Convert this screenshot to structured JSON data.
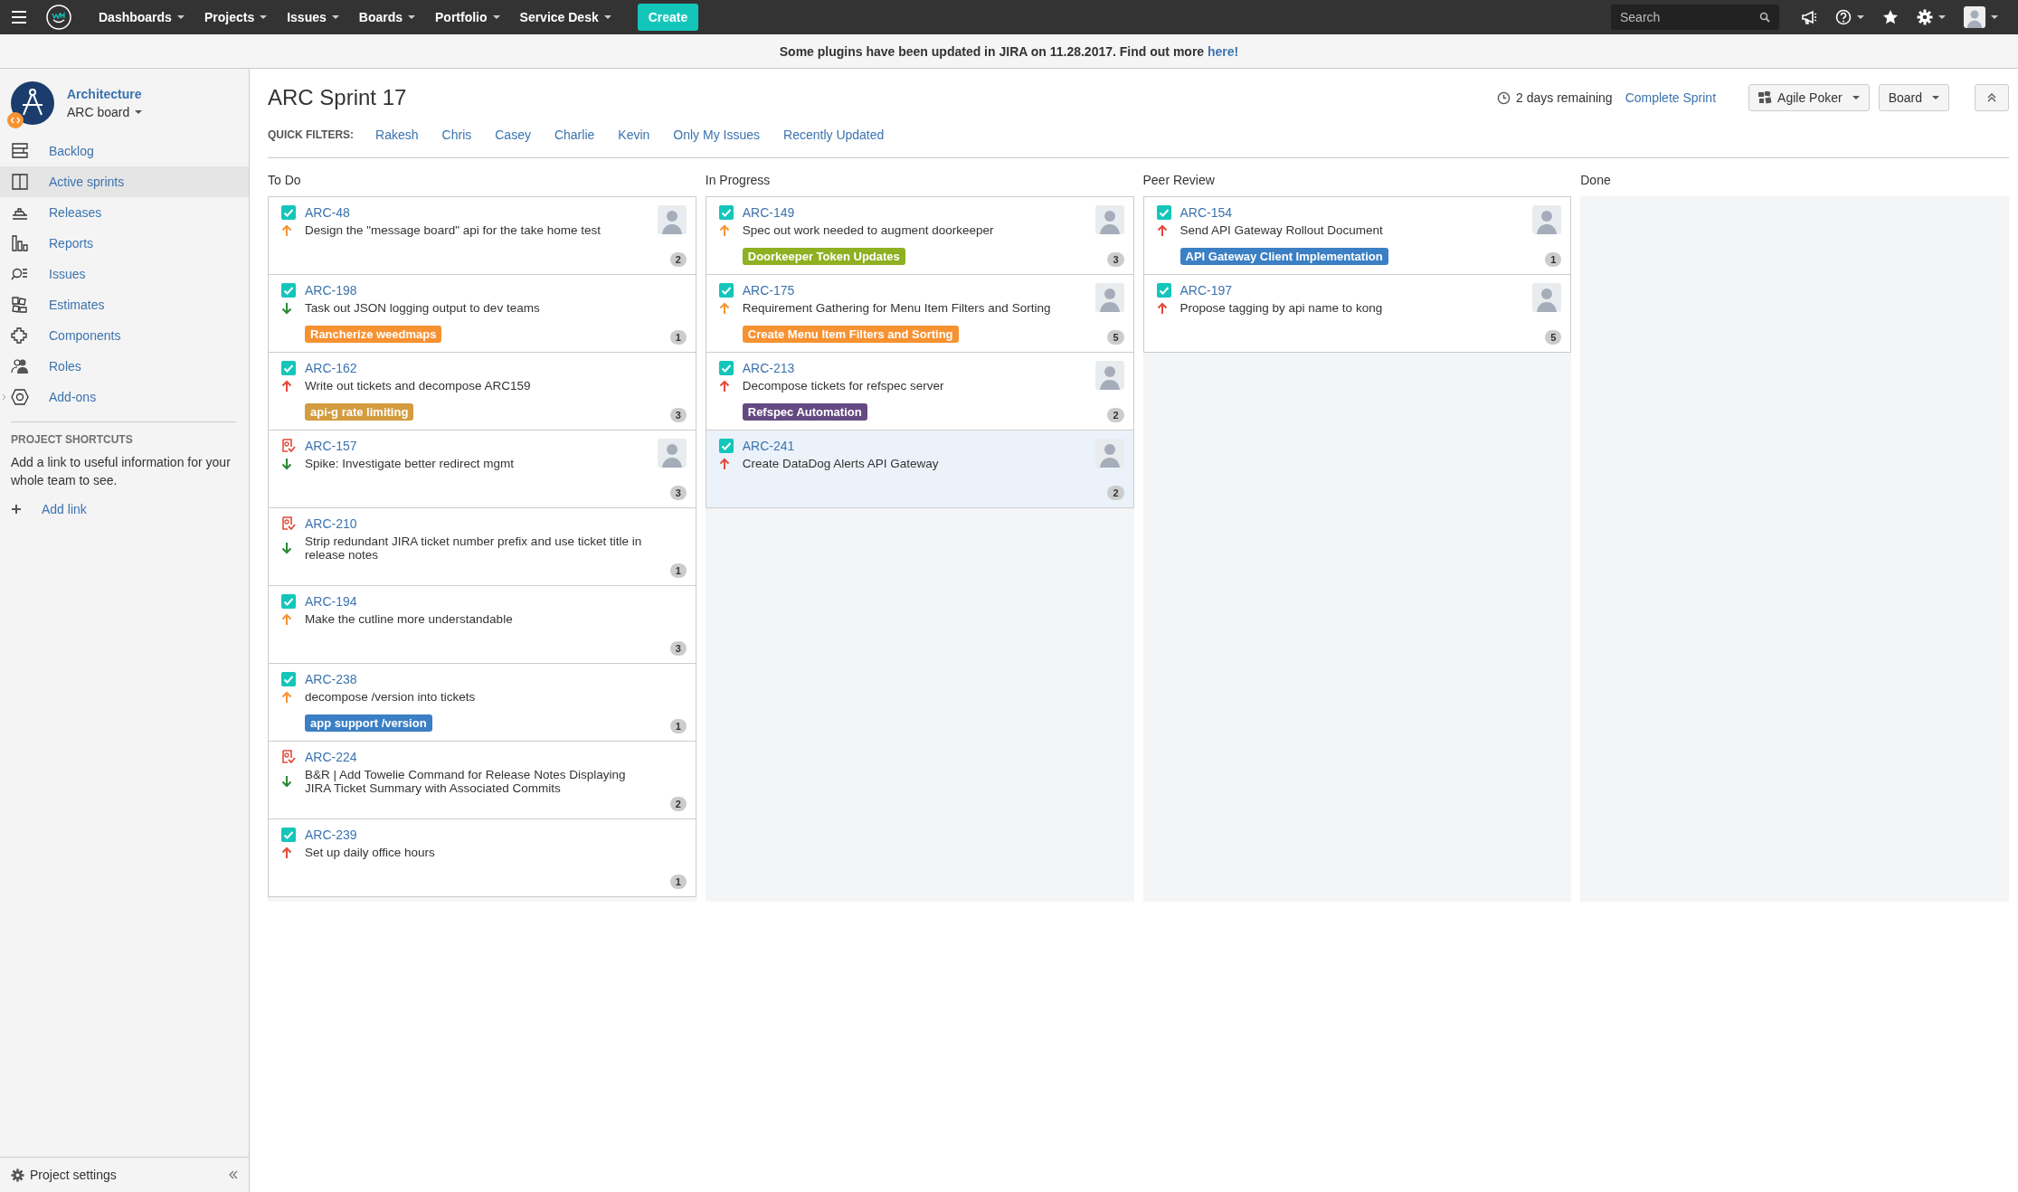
{
  "top_nav": {
    "menus": [
      {
        "label": "Dashboards"
      },
      {
        "label": "Projects"
      },
      {
        "label": "Issues"
      },
      {
        "label": "Boards"
      },
      {
        "label": "Portfolio"
      },
      {
        "label": "Service Desk"
      }
    ],
    "create_button": "Create",
    "search": {
      "placeholder": "Search"
    }
  },
  "banner": {
    "text": "Some plugins have been updated in JIRA on 11.28.2017. Find out more",
    "link": "here!"
  },
  "sidebar": {
    "project_name": "Architecture",
    "board_name": "ARC board",
    "items": [
      {
        "label": "Backlog",
        "selected": false
      },
      {
        "label": "Active sprints",
        "selected": true
      },
      {
        "label": "Releases",
        "selected": false
      },
      {
        "label": "Reports",
        "selected": false
      },
      {
        "label": "Issues",
        "selected": false
      },
      {
        "label": "Estimates",
        "selected": false
      },
      {
        "label": "Components",
        "selected": false
      },
      {
        "label": "Roles",
        "selected": false
      },
      {
        "label": "Add-ons",
        "selected": false
      }
    ],
    "shortcuts": {
      "heading": "PROJECT SHORTCUTS",
      "text": "Add a link to useful information for your whole team to see.",
      "add_link": "Add link"
    },
    "footer": "Project settings"
  },
  "board": {
    "title": "ARC Sprint 17",
    "remaining": "2 days remaining",
    "complete_sprint": "Complete Sprint",
    "buttons": [
      "Agile Poker",
      "Board"
    ],
    "quick_filters": {
      "label": "QUICK FILTERS:",
      "filters": [
        "Rakesh",
        "Chris",
        "Casey",
        "Charlie",
        "Kevin",
        "Only My Issues",
        "Recently Updated"
      ]
    },
    "columns": [
      {
        "name": "To Do",
        "cards": [
          {
            "key": "ARC-48",
            "kind": "task",
            "priority": {
              "kind": "high"
            },
            "summary": "Design the \"message board\" api for the take home test",
            "avatar": true,
            "estimate": "2",
            "selected": false
          },
          {
            "key": "ARC-198",
            "kind": "task",
            "priority": {
              "kind": "low"
            },
            "summary": "Task out JSON logging output to dev teams",
            "epic": {
              "label": "Rancherize weedmaps",
              "color": "#f79232"
            },
            "avatar": false,
            "estimate": "1",
            "selected": false
          },
          {
            "key": "ARC-162",
            "kind": "task",
            "priority": {
              "kind": "highest"
            },
            "summary": "Write out tickets and decompose ARC159",
            "epic": {
              "label": "api-g rate limiting",
              "color": "#d39c3f"
            },
            "avatar": false,
            "estimate": "3",
            "selected": false
          },
          {
            "key": "ARC-157",
            "kind": "spike",
            "priority": {
              "kind": "low"
            },
            "summary": "Spike: Investigate better redirect mgmt",
            "avatar": true,
            "estimate": "3",
            "selected": false
          },
          {
            "key": "ARC-210",
            "kind": "spike",
            "priority": {
              "kind": "low"
            },
            "summary": "Strip redundant JIRA ticket number prefix and use ticket title in release notes",
            "avatar": false,
            "estimate": "1",
            "selected": false
          },
          {
            "key": "ARC-194",
            "kind": "task",
            "priority": {
              "kind": "high"
            },
            "summary": "Make the cutline more understandable",
            "avatar": false,
            "estimate": "3",
            "selected": false
          },
          {
            "key": "ARC-238",
            "kind": "task",
            "priority": {
              "kind": "high"
            },
            "summary": "decompose /version into tickets",
            "epic": {
              "label": "app support /version",
              "color": "#3b7fc4"
            },
            "avatar": false,
            "estimate": "1",
            "selected": false
          },
          {
            "key": "ARC-224",
            "kind": "spike",
            "priority": {
              "kind": "low"
            },
            "summary": "B&R | Add Towelie Command for Release Notes Displaying JIRA Ticket Summary with Associated Commits",
            "avatar": false,
            "estimate": "2",
            "selected": false
          },
          {
            "key": "ARC-239",
            "kind": "task",
            "priority": {
              "kind": "highest"
            },
            "summary": "Set up daily office hours",
            "avatar": false,
            "estimate": "1",
            "selected": false
          }
        ]
      },
      {
        "name": "In Progress",
        "cards": [
          {
            "key": "ARC-149",
            "kind": "task",
            "priority": {
              "kind": "high"
            },
            "summary": "Spec out work needed to augment doorkeeper",
            "epic": {
              "label": "Doorkeeper Token Updates",
              "color": "#8eb021"
            },
            "avatar": true,
            "estimate": "3",
            "selected": false
          },
          {
            "key": "ARC-175",
            "kind": "task",
            "priority": {
              "kind": "high"
            },
            "summary": "Requirement Gathering for Menu Item Filters and Sorting",
            "epic": {
              "label": "Create Menu Item Filters and Sorting",
              "color": "#f79232"
            },
            "avatar": true,
            "estimate": "5",
            "selected": false
          },
          {
            "key": "ARC-213",
            "kind": "task",
            "priority": {
              "kind": "highest"
            },
            "summary": "Decompose tickets for refspec server",
            "epic": {
              "label": "Refspec Automation",
              "color": "#654982"
            },
            "avatar": true,
            "estimate": "2",
            "selected": false
          },
          {
            "key": "ARC-241",
            "kind": "task",
            "priority": {
              "kind": "highest"
            },
            "summary": "Create DataDog Alerts API Gateway",
            "avatar": true,
            "estimate": "2",
            "selected": true
          }
        ]
      },
      {
        "name": "Peer Review",
        "cards": [
          {
            "key": "ARC-154",
            "kind": "task",
            "priority": {
              "kind": "highest"
            },
            "summary": "Send API Gateway Rollout Document",
            "epic": {
              "label": "API Gateway Client Implementation",
              "color": "#3b7fc4"
            },
            "avatar": true,
            "estimate": "1",
            "selected": false
          },
          {
            "key": "ARC-197",
            "kind": "task",
            "priority": {
              "kind": "highest"
            },
            "summary": "Propose tagging by api name to kong",
            "avatar": true,
            "estimate": "5",
            "selected": false
          }
        ]
      },
      {
        "name": "Done"
      }
    ]
  }
}
